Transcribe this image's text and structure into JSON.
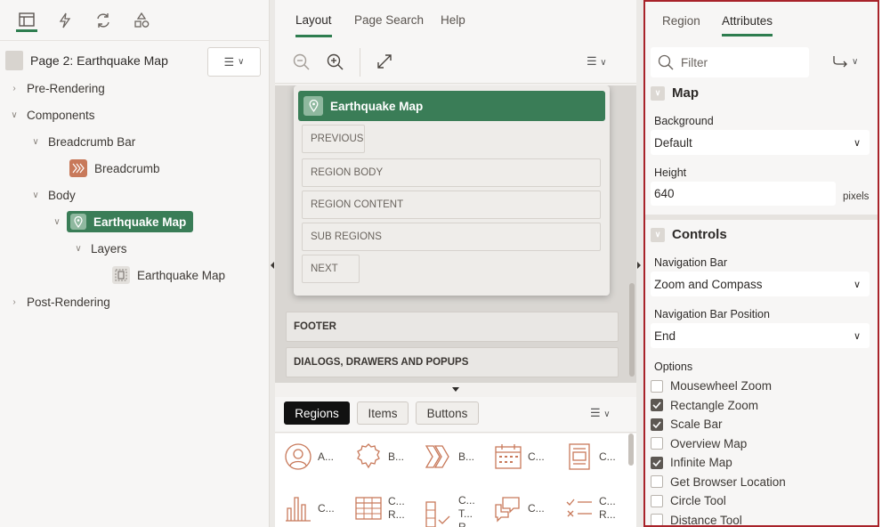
{
  "left": {
    "page_title": "Page 2: Earthquake Map",
    "tree": {
      "pre_rendering": "Pre-Rendering",
      "components": "Components",
      "breadcrumb_bar": "Breadcrumb Bar",
      "breadcrumb": "Breadcrumb",
      "body": "Body",
      "earthquake_map": "Earthquake Map",
      "layers": "Layers",
      "layer_earthquake_map": "Earthquake Map",
      "post_rendering": "Post-Rendering"
    }
  },
  "center": {
    "tabs": [
      "Layout",
      "Page Search",
      "Help"
    ],
    "card_title": "Earthquake Map",
    "slots": [
      "PREVIOUS",
      "REGION BODY",
      "REGION CONTENT",
      "SUB REGIONS",
      "NEXT"
    ],
    "regions": [
      "FOOTER",
      "DIALOGS, DRAWERS AND POPUPS"
    ],
    "gallery_tabs": [
      "Regions",
      "Items",
      "Buttons"
    ],
    "gallery_items": [
      {
        "label": "A..."
      },
      {
        "label": "B..."
      },
      {
        "label": "B..."
      },
      {
        "label": "C..."
      },
      {
        "label": "C..."
      },
      {
        "label": "C..."
      },
      {
        "label": "C... R..."
      },
      {
        "label": "C... T... R..."
      },
      {
        "label": "C..."
      },
      {
        "label": "C... R..."
      }
    ]
  },
  "right": {
    "tabs": [
      "Region",
      "Attributes"
    ],
    "filter_placeholder": "Filter",
    "map": {
      "heading": "Map",
      "background_label": "Background",
      "background_value": "Default",
      "height_label": "Height",
      "height_value": "640",
      "height_unit": "pixels"
    },
    "controls": {
      "heading": "Controls",
      "nav_bar_label": "Navigation Bar",
      "nav_bar_value": "Zoom and Compass",
      "nav_pos_label": "Navigation Bar Position",
      "nav_pos_value": "End",
      "options_label": "Options",
      "options": [
        {
          "label": "Mousewheel Zoom",
          "checked": false
        },
        {
          "label": "Rectangle Zoom",
          "checked": true
        },
        {
          "label": "Scale Bar",
          "checked": true
        },
        {
          "label": "Overview Map",
          "checked": false
        },
        {
          "label": "Infinite Map",
          "checked": true
        },
        {
          "label": "Get Browser Location",
          "checked": false
        },
        {
          "label": "Circle Tool",
          "checked": false
        },
        {
          "label": "Distance Tool",
          "checked": false
        }
      ]
    }
  },
  "colors": {
    "accent_green": "#3a7d57",
    "highlight_border": "#a8232a",
    "icon_orange": "#c8795a"
  }
}
